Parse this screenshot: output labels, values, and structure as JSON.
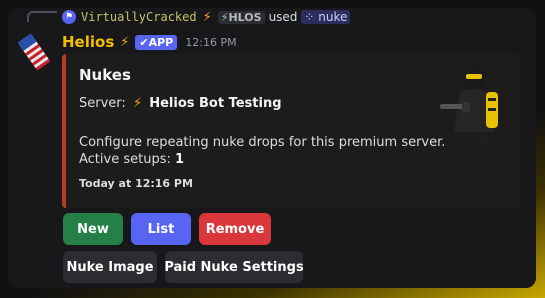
{
  "reply": {
    "username": "VirtuallyCracked",
    "role_tag": "⚡HLOS",
    "used_text": "used",
    "command": "nuke"
  },
  "header": {
    "bot_name": "Helios",
    "app_badge": "✔APP",
    "timestamp": "12:16 PM"
  },
  "embed": {
    "accent_color": "#b53d28",
    "title": "Nukes",
    "server_label": "Server:",
    "server_icon": "lightning-bolt-emoji",
    "server_name": "Helios Bot Testing",
    "description": "Configure repeating nuke drops for this premium server.",
    "active_label": "Active setups:",
    "active_count": "1",
    "footer": "Today at 12:16 PM"
  },
  "buttons": {
    "new": "New",
    "list": "List",
    "remove": "Remove",
    "nuke_image": "Nuke Image",
    "paid_settings": "Paid Nuke Settings"
  }
}
